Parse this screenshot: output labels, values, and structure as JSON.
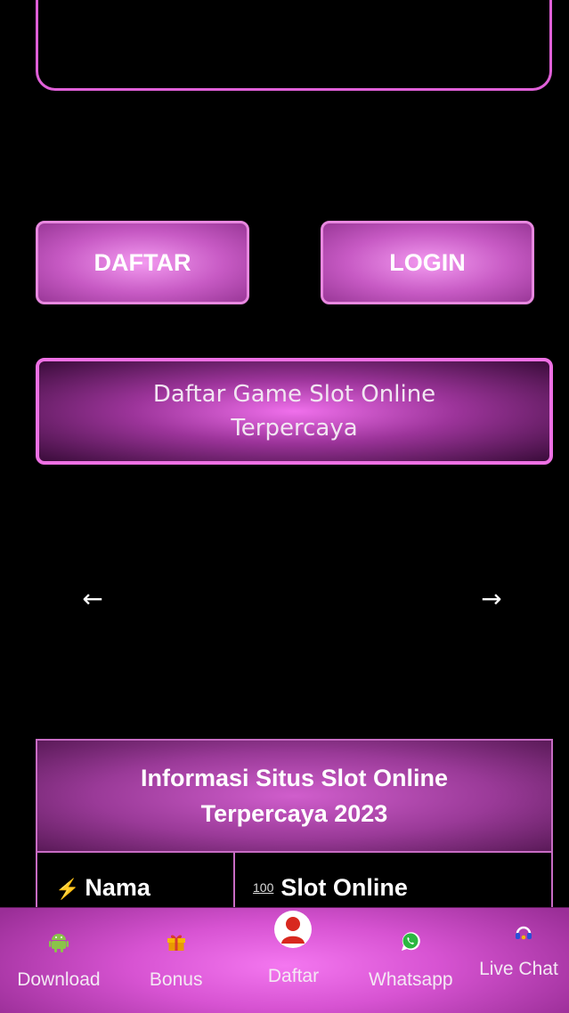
{
  "auth": {
    "register_label": "DAFTAR",
    "login_label": "LOGIN"
  },
  "site_title": "Daftar Game Slot Online Terpercaya",
  "slider": {
    "prev": "←",
    "next": "→"
  },
  "info_table": {
    "heading": "Informasi Situs Slot Online Terpercaya 2023",
    "rows": [
      {
        "key": "Nama",
        "value": "Slot Online"
      }
    ]
  },
  "bottom_nav": [
    {
      "label": "Download",
      "icon": "android-icon"
    },
    {
      "label": "Bonus",
      "icon": "gift-icon"
    },
    {
      "label": "Daftar",
      "icon": "user-icon"
    },
    {
      "label": "Whatsapp",
      "icon": "whatsapp-icon"
    },
    {
      "label": "Live Chat",
      "icon": "headset-icon"
    }
  ],
  "colors": {
    "accent": "#e060d8",
    "background": "#000000",
    "nav_bg": "#d753d2"
  }
}
